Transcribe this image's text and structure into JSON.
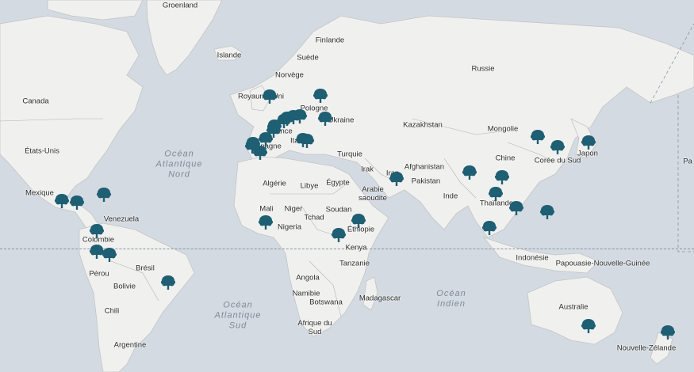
{
  "map": {
    "colors": {
      "ocean": "#d3dae2",
      "land": "#f0f0ef",
      "border": "#b8b8b8",
      "marker": "#1f5f73"
    },
    "labels": {
      "groenland": "Groenland",
      "islande": "Islande",
      "finlande": "Finlande",
      "suede": "Suède",
      "norvege": "Norvège",
      "russie": "Russie",
      "canada": "Canada",
      "royaume_uni": "Royaume-Uni",
      "pologne": "Pologne",
      "ukraine": "Ukraine",
      "kazakhstan": "Kazakhstan",
      "mongolie": "Mongolie",
      "etats_unis": "États-Unis",
      "france": "France",
      "espagne": "Espagne",
      "italie": "Italie",
      "turquie": "Turquie",
      "chine": "Chine",
      "coree_du_sud": "Corée du Sud",
      "japon": "Japon",
      "irak": "Irak",
      "iran": "Iran",
      "afghanistan": "Afghanistan",
      "pakistan": "Pakistan",
      "algerie": "Algérie",
      "libye": "Libye",
      "egypte": "Égypte",
      "arabie_saoudite": "Arabie saoudite",
      "inde": "Inde",
      "thailande": "Thaïlande",
      "mexique": "Mexique",
      "mali": "Mali",
      "niger": "Niger",
      "tchad": "Tchad",
      "soudan": "Soudan",
      "venezuela": "Venezuela",
      "nigeria": "Nigeria",
      "ethiopie": "Éthiopie",
      "colombie": "Colombie",
      "kenya": "Kenya",
      "indonesie": "Indonésie",
      "papouasie": "Papouasie-Nouvelle-Guinée",
      "perou": "Pérou",
      "bresil": "Brésil",
      "tanzanie": "Tanzanie",
      "bolivie": "Bolivie",
      "angola": "Angola",
      "namibie": "Namibie",
      "botswana": "Botswana",
      "madagascar": "Madagascar",
      "australie": "Australie",
      "chili": "Chili",
      "afrique_du_sud": "Afrique du Sud",
      "argentine": "Argentine",
      "nouvelle_zelande": "Nouvelle-Zélande",
      "edge_pa": "Pa"
    },
    "oceans": {
      "atlantique_nord": [
        "Océan",
        "Atlantique",
        "Nord"
      ],
      "atlantique_sud": [
        "Océan",
        "Atlantique",
        "Sud"
      ],
      "indien": [
        "Océan",
        "Indien"
      ]
    },
    "markers_icon": "tree-icon",
    "marker_count": 37
  }
}
